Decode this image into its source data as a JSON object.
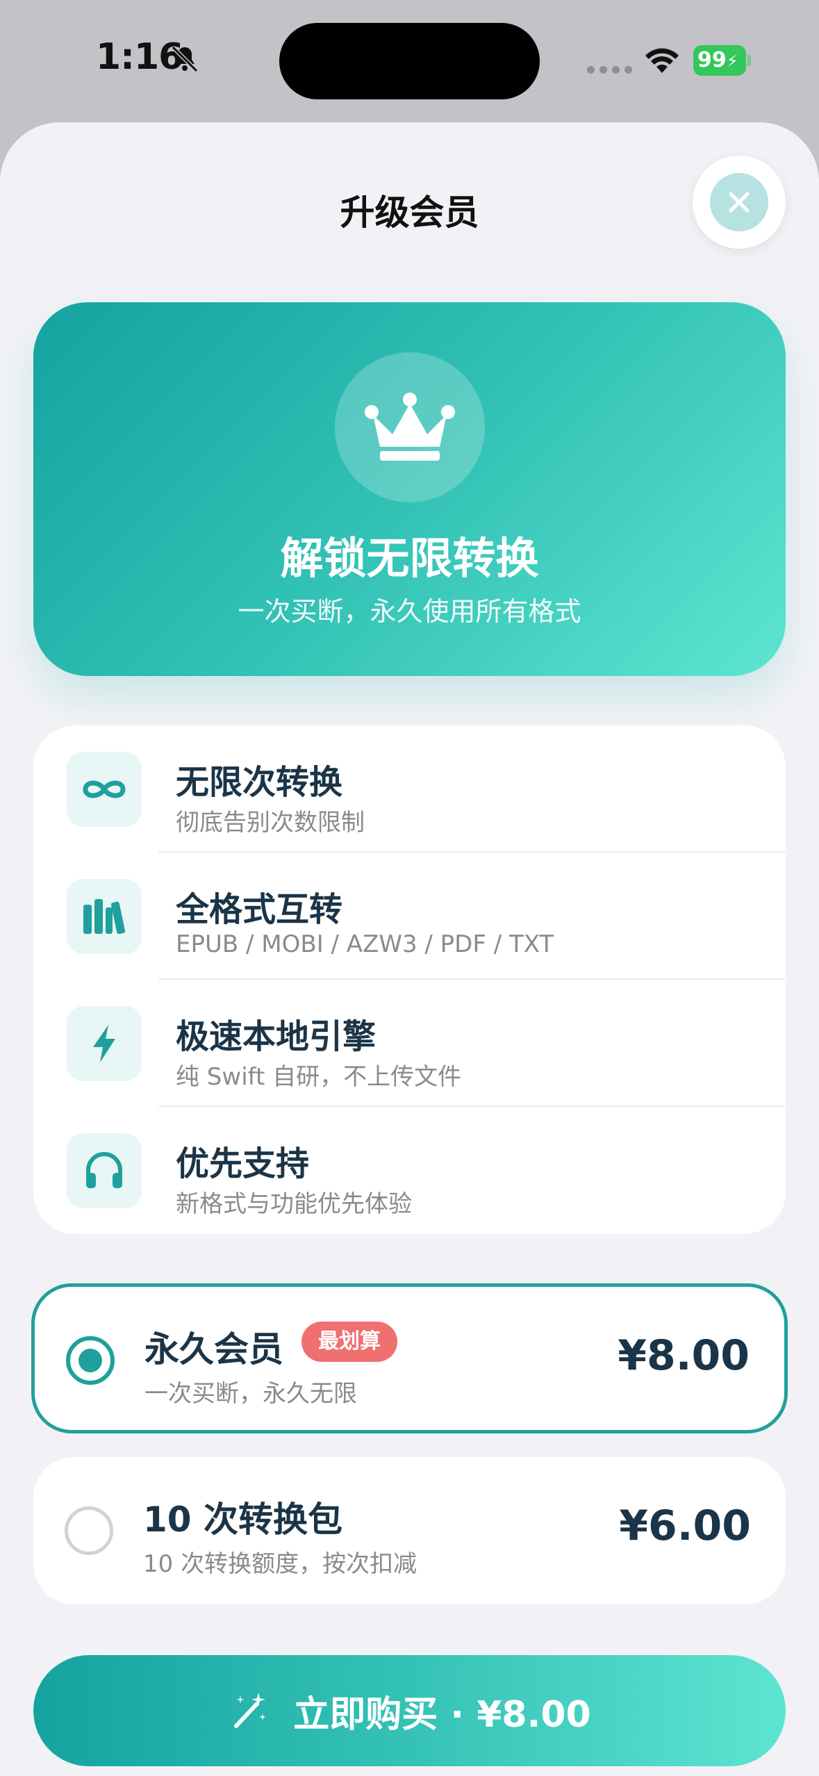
{
  "status_bar": {
    "time": "1:16",
    "battery": "99"
  },
  "sheet": {
    "title": "升级会员"
  },
  "hero": {
    "title": "解锁无限转换",
    "subtitle": "一次买断，永久使用所有格式",
    "icon": "crown-icon"
  },
  "features": [
    {
      "icon": "infinity-icon",
      "title": "无限次转换",
      "subtitle": "彻底告别次数限制"
    },
    {
      "icon": "books-icon",
      "title": "全格式互转",
      "subtitle": "EPUB / MOBI / AZW3 / PDF / TXT"
    },
    {
      "icon": "bolt-icon",
      "title": "极速本地引擎",
      "subtitle": "纯 Swift 自研，不上传文件"
    },
    {
      "icon": "headphones-icon",
      "title": "优先支持",
      "subtitle": "新格式与功能优先体验"
    }
  ],
  "plans": [
    {
      "title": "永久会员",
      "badge": "最划算",
      "subtitle": "一次买断，永久无限",
      "price": "¥8.00",
      "selected": true
    },
    {
      "title": "10 次转换包",
      "subtitle": "10 次转换额度，按次扣减",
      "price": "¥6.00",
      "selected": false
    }
  ],
  "buy_button": {
    "label": "立即购买 · ¥8.00"
  },
  "colors": {
    "accent": "#1fa09c",
    "gradient_start": "#14a3a0",
    "gradient_end": "#5de5d1",
    "badge": "#f07070",
    "text_dark": "#1b3447"
  }
}
